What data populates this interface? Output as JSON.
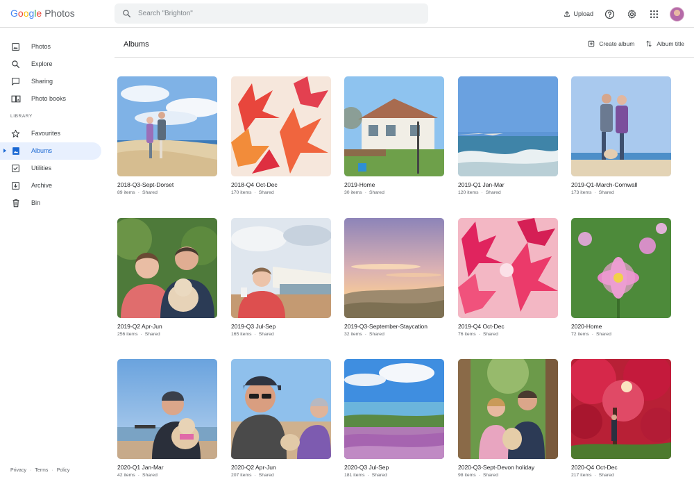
{
  "app": {
    "logo_text": "Google",
    "product_name": "Photos"
  },
  "search": {
    "placeholder": "Search \"Brighton\""
  },
  "top_actions": {
    "upload_label": "Upload"
  },
  "sidebar": {
    "items": [
      {
        "label": "Photos",
        "icon": "photo-icon"
      },
      {
        "label": "Explore",
        "icon": "search-icon"
      },
      {
        "label": "Sharing",
        "icon": "chat-bubble-icon"
      },
      {
        "label": "Photo books",
        "icon": "book-icon"
      }
    ],
    "library_label": "LIBRARY",
    "library_items": [
      {
        "label": "Favourites",
        "icon": "star-icon"
      },
      {
        "label": "Albums",
        "icon": "album-icon",
        "active": true
      },
      {
        "label": "Utilities",
        "icon": "utilities-icon"
      },
      {
        "label": "Archive",
        "icon": "archive-icon"
      },
      {
        "label": "Bin",
        "icon": "trash-icon"
      }
    ],
    "footer": [
      "Privacy",
      "Terms",
      "Policy"
    ]
  },
  "main": {
    "title": "Albums",
    "create_album_label": "Create album",
    "sort_label": "Album title"
  },
  "albums": [
    {
      "title": "2018-Q3-Sept-Dorset",
      "count": "89 items",
      "status": "Shared"
    },
    {
      "title": "2018-Q4 Oct-Dec",
      "count": "170 items",
      "status": "Shared"
    },
    {
      "title": "2019-Home",
      "count": "30 items",
      "status": "Shared"
    },
    {
      "title": "2019-Q1 Jan-Mar",
      "count": "120 items",
      "status": "Shared"
    },
    {
      "title": "2019-Q1-March-Cornwall",
      "count": "173 items",
      "status": "Shared"
    },
    {
      "title": "2019-Q2 Apr-Jun",
      "count": "256 items",
      "status": "Shared"
    },
    {
      "title": "2019-Q3 Jul-Sep",
      "count": "165 items",
      "status": "Shared"
    },
    {
      "title": "2019-Q3-September-Staycation",
      "count": "32 items",
      "status": "Shared"
    },
    {
      "title": "2019-Q4 Oct-Dec",
      "count": "76 items",
      "status": "Shared"
    },
    {
      "title": "2020-Home",
      "count": "72 items",
      "status": "Shared"
    },
    {
      "title": "2020-Q1 Jan-Mar",
      "count": "42 items",
      "status": "Shared"
    },
    {
      "title": "2020-Q2 Apr-Jun",
      "count": "207 items",
      "status": "Shared"
    },
    {
      "title": "2020-Q3 Jul-Sep",
      "count": "181 items",
      "status": "Shared"
    },
    {
      "title": "2020-Q3-Sept-Devon holiday",
      "count": "98 items",
      "status": "Shared"
    },
    {
      "title": "2020-Q4 Oct-Dec",
      "count": "217 items",
      "status": "Shared"
    }
  ],
  "colors": {
    "accent": "#1967d2",
    "active_bg": "#e8f0fe"
  }
}
